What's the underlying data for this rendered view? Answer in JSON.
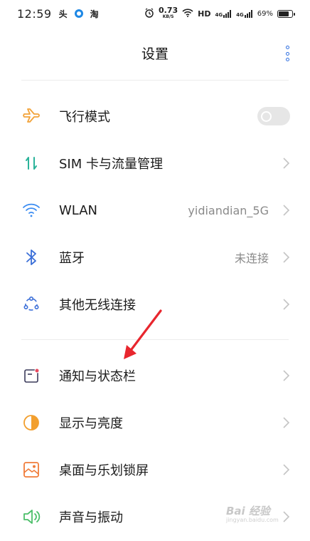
{
  "status_bar": {
    "time": "12:59",
    "app_icons": [
      "头",
      "淘"
    ],
    "speed": "0.73",
    "speed_unit": "KB/S",
    "network": "HD",
    "signal_4g_1": "4G",
    "signal_4g_2": "4G",
    "battery": "69%"
  },
  "header": {
    "title": "设置"
  },
  "settings": {
    "airplane": {
      "label": "飞行模式",
      "icon": "airplane-icon",
      "toggle_on": false
    },
    "sim": {
      "label": "SIM 卡与流量管理",
      "icon": "sim-transfer-icon"
    },
    "wlan": {
      "label": "WLAN",
      "value": "yidiandian_5G",
      "icon": "wifi-icon"
    },
    "bluetooth": {
      "label": "蓝牙",
      "value": "未连接",
      "icon": "bluetooth-icon"
    },
    "other_wireless": {
      "label": "其他无线连接",
      "icon": "wireless-connect-icon"
    },
    "notification": {
      "label": "通知与状态栏",
      "icon": "notification-icon"
    },
    "display": {
      "label": "显示与亮度",
      "icon": "brightness-icon"
    },
    "desktop": {
      "label": "桌面与乐划锁屏",
      "icon": "wallpaper-icon"
    },
    "sound": {
      "label": "声音与振动",
      "icon": "speaker-icon"
    }
  },
  "colors": {
    "accent_blue": "#2f6fe0",
    "airplane_orange": "#f2a33a",
    "sim_green": "#2bb39a",
    "wifi_blue": "#3b8cf2",
    "notification_red": "#e84a5f",
    "display_orange": "#f29f2e",
    "sound_green": "#4cbf6a",
    "annotation_red": "#e8262e"
  },
  "watermark": {
    "brand": "Bai 经验",
    "url": "jingyan.baidu.com"
  }
}
